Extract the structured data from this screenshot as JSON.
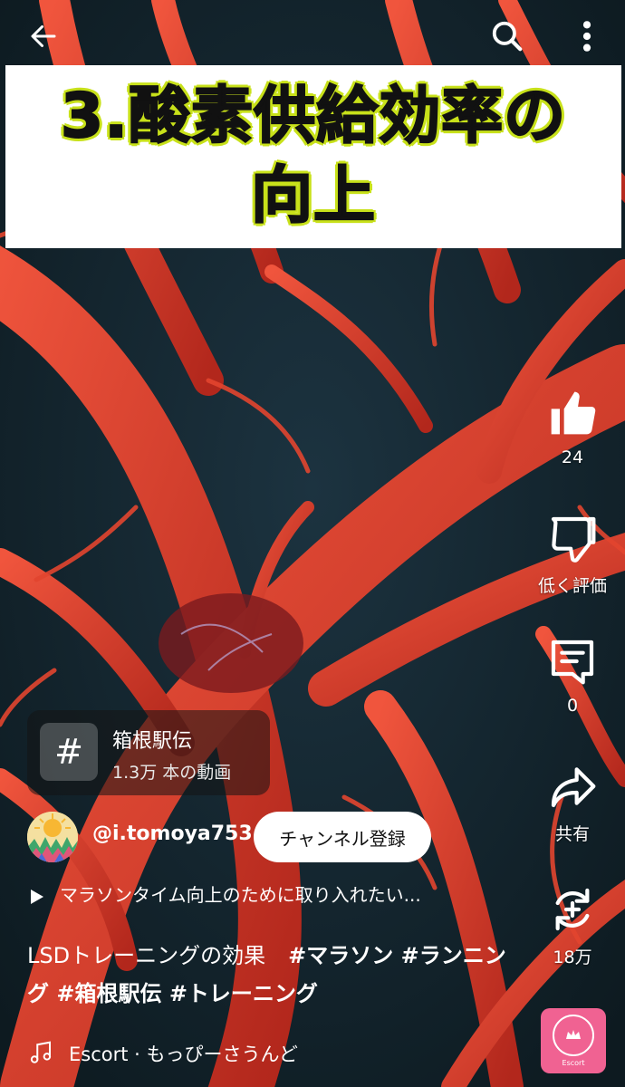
{
  "overlay": {
    "title_line1": "3.酸素供給効率の",
    "title_line2": "向上"
  },
  "actions": {
    "like_count": "24",
    "dislike_label": "低く評価",
    "comment_count": "0",
    "share_label": "共有",
    "remix_count": "18万"
  },
  "hashtag_chip": {
    "symbol": "#",
    "name": "箱根駅伝",
    "count": "1.3万 本の動画"
  },
  "channel": {
    "handle": "@i.tomoya753",
    "subscribe_label": "チャンネル登録"
  },
  "playlist": {
    "text": "マラソンタイム向上のために取り入れたい..."
  },
  "description": {
    "text": "LSDトレーニングの効果",
    "tags": "#マラソン #ランニング #箱根駅伝 #トレーニング"
  },
  "music": {
    "text": "Escort · もっぴーさうんど"
  },
  "sound_thumb": {
    "label": "Escort"
  },
  "colors": {
    "title_outline": "#c8e11a",
    "vessel_red": "#d8392a",
    "background": "#14232a"
  }
}
